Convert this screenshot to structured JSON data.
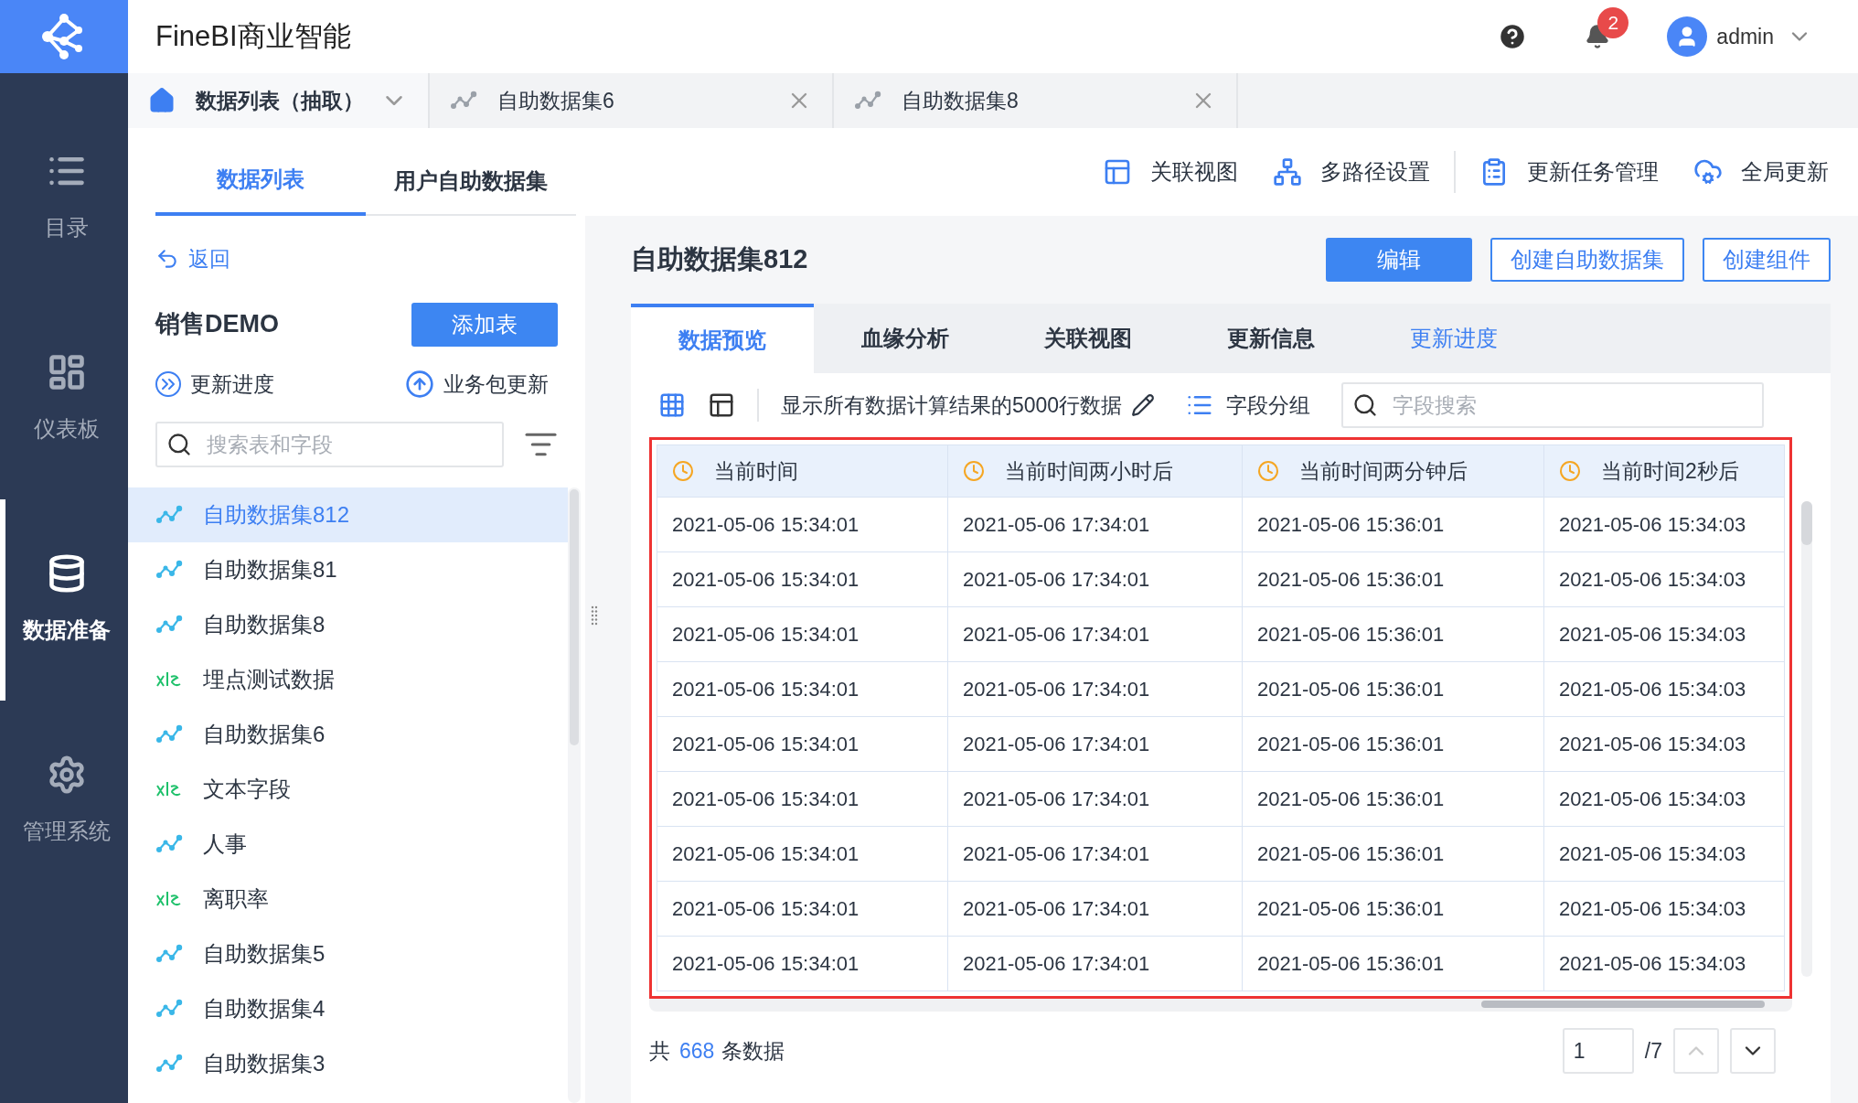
{
  "header": {
    "title": "FineBI商业智能",
    "notifications": "2",
    "user": "admin"
  },
  "nav": [
    {
      "label": "目录",
      "selected": false
    },
    {
      "label": "仪表板",
      "selected": false
    },
    {
      "label": "数据准备",
      "selected": true
    },
    {
      "label": "管理系统",
      "selected": false
    }
  ],
  "tabs": [
    {
      "label": "数据列表（抽取）",
      "kind": "home",
      "selected": true
    },
    {
      "label": "自助数据集6",
      "kind": "dataset",
      "selected": false
    },
    {
      "label": "自助数据集8",
      "kind": "dataset",
      "selected": false
    }
  ],
  "panel_tabs": [
    {
      "label": "数据列表",
      "selected": true
    },
    {
      "label": "用户自助数据集",
      "selected": false
    }
  ],
  "toolbar": [
    {
      "label": "关联视图"
    },
    {
      "label": "多路径设置"
    },
    {
      "label": "更新任务管理"
    },
    {
      "label": "全局更新"
    }
  ],
  "sidebar": {
    "back": "返回",
    "package": "销售DEMO",
    "add_button": "添加表",
    "progress": "更新进度",
    "package_update": "业务包更新",
    "search_placeholder": "搜索表和字段",
    "items": [
      {
        "label": "自助数据集812",
        "kind": "dataset",
        "selected": true
      },
      {
        "label": "自助数据集81",
        "kind": "dataset",
        "selected": false
      },
      {
        "label": "自助数据集8",
        "kind": "dataset",
        "selected": false
      },
      {
        "label": "埋点测试数据",
        "kind": "xls",
        "selected": false
      },
      {
        "label": "自助数据集6",
        "kind": "dataset",
        "selected": false
      },
      {
        "label": "文本字段",
        "kind": "xls",
        "selected": false
      },
      {
        "label": "人事",
        "kind": "dataset",
        "selected": false
      },
      {
        "label": "离职率",
        "kind": "xls",
        "selected": false
      },
      {
        "label": "自助数据集5",
        "kind": "dataset",
        "selected": false
      },
      {
        "label": "自助数据集4",
        "kind": "dataset",
        "selected": false
      },
      {
        "label": "自助数据集3",
        "kind": "dataset",
        "selected": false
      }
    ]
  },
  "detail": {
    "title": "自助数据集812",
    "buttons": [
      {
        "label": "编辑",
        "kind": "primary"
      },
      {
        "label": "创建自助数据集",
        "kind": "outline"
      },
      {
        "label": "创建组件",
        "kind": "outline"
      }
    ],
    "tabs": [
      {
        "label": "数据预览",
        "kind": "tab",
        "selected": true
      },
      {
        "label": "血缘分析",
        "kind": "tab",
        "selected": false
      },
      {
        "label": "关联视图",
        "kind": "tab",
        "selected": false
      },
      {
        "label": "更新信息",
        "kind": "tab",
        "selected": false
      },
      {
        "label": "更新进度",
        "kind": "link",
        "selected": false
      }
    ],
    "preview_note": "显示所有数据计算结果的5000行数据",
    "group_button": "字段分组",
    "field_search_placeholder": "字段搜索"
  },
  "table": {
    "columns": [
      "当前时间",
      "当前时间两小时后",
      "当前时间两分钟后",
      "当前时间2秒后"
    ],
    "rows": [
      [
        "2021-05-06 15:34:01",
        "2021-05-06 17:34:01",
        "2021-05-06 15:36:01",
        "2021-05-06 15:34:03"
      ],
      [
        "2021-05-06 15:34:01",
        "2021-05-06 17:34:01",
        "2021-05-06 15:36:01",
        "2021-05-06 15:34:03"
      ],
      [
        "2021-05-06 15:34:01",
        "2021-05-06 17:34:01",
        "2021-05-06 15:36:01",
        "2021-05-06 15:34:03"
      ],
      [
        "2021-05-06 15:34:01",
        "2021-05-06 17:34:01",
        "2021-05-06 15:36:01",
        "2021-05-06 15:34:03"
      ],
      [
        "2021-05-06 15:34:01",
        "2021-05-06 17:34:01",
        "2021-05-06 15:36:01",
        "2021-05-06 15:34:03"
      ],
      [
        "2021-05-06 15:34:01",
        "2021-05-06 17:34:01",
        "2021-05-06 15:36:01",
        "2021-05-06 15:34:03"
      ],
      [
        "2021-05-06 15:34:01",
        "2021-05-06 17:34:01",
        "2021-05-06 15:36:01",
        "2021-05-06 15:34:03"
      ],
      [
        "2021-05-06 15:34:01",
        "2021-05-06 17:34:01",
        "2021-05-06 15:36:01",
        "2021-05-06 15:34:03"
      ],
      [
        "2021-05-06 15:34:01",
        "2021-05-06 17:34:01",
        "2021-05-06 15:36:01",
        "2021-05-06 15:34:03"
      ]
    ]
  },
  "footer": {
    "total_prefix": "共",
    "total_count": "668",
    "total_suffix": "条数据",
    "page": "1",
    "page_count": "/7"
  }
}
